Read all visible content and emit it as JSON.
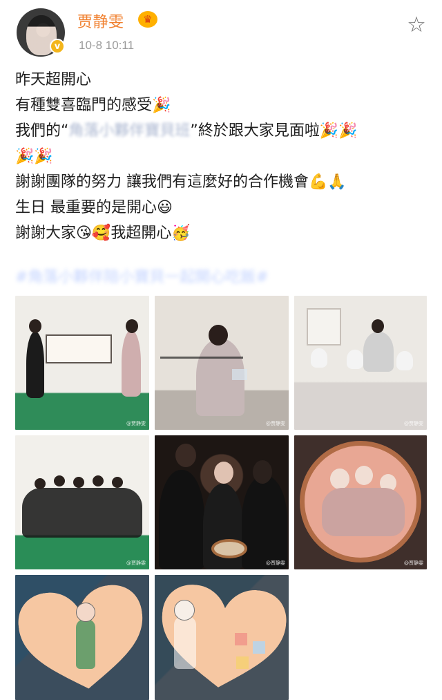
{
  "header": {
    "username": "贾静雯",
    "timestamp": "10-8 10:11",
    "verified_mark": "v",
    "crown_mark": "♛",
    "favorite_icon": "☆"
  },
  "post": {
    "lines": [
      "昨天超開心",
      "有種雙喜臨門的感受🎉",
      "我們的“",
      "角落小夥伴寶貝班",
      "”終於跟大家見面啦🎉🎉",
      "🎉🎉",
      "謝謝團隊的努力 讓我們有這麼好的合作機會💪🙏",
      "生日 最重要的是開心😃",
      "謝謝大家😘🥰我超開心🥳"
    ],
    "hashtag": "#角落小夥伴陪小寶貝一起開心吃飯#"
  },
  "photos": {
    "watermarks": [
      "@贾静雯",
      "@贾静雯",
      "@贾静雯",
      "@贾静雯",
      "@贾静雯",
      "@贾静雯",
      "",
      ""
    ]
  },
  "colors": {
    "username": "#f07f2d",
    "hashtag": "#bfd0ff",
    "timestamp": "#9a9a9a"
  },
  "icons": {
    "favorite": "star-icon",
    "verified": "verified-icon",
    "crown": "crown-icon"
  }
}
